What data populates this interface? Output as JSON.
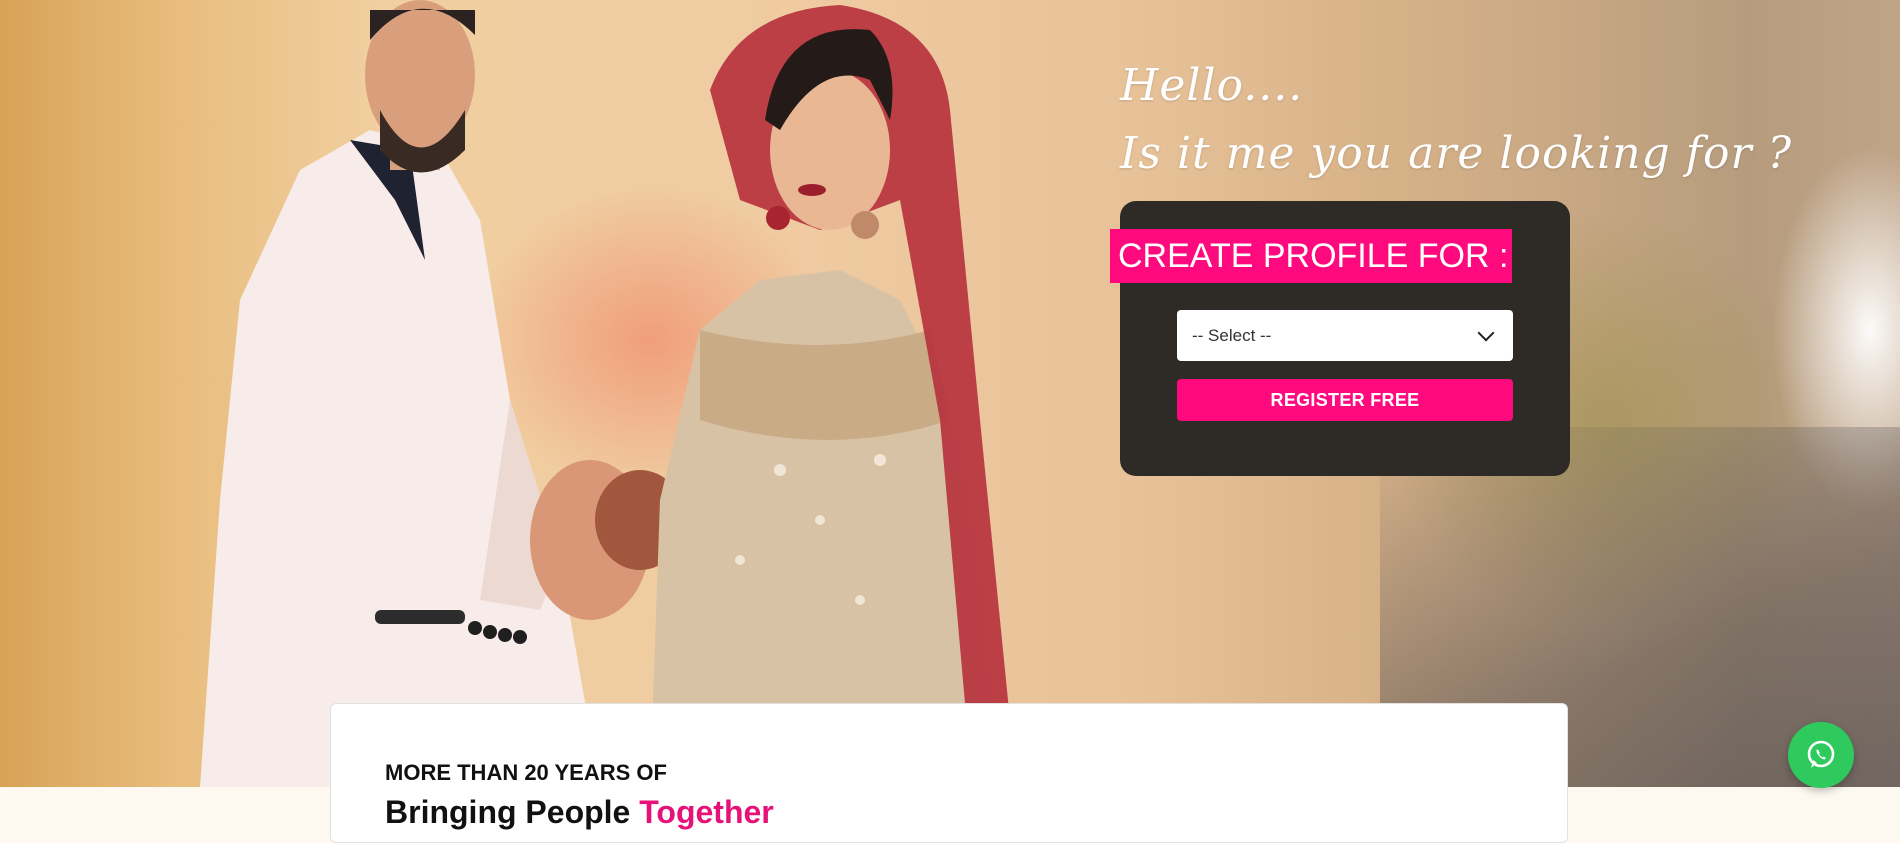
{
  "hero": {
    "greeting_line1": "Hello....",
    "greeting_line2": "Is it me you are looking for ?",
    "photo_label": "Bride and groom photo"
  },
  "profile_form": {
    "heading": "CREATE PROFILE FOR :",
    "select_value": "-- Select --",
    "register_button": "REGISTER FREE"
  },
  "about": {
    "subheading": "MORE THAN 20 YEARS OF",
    "title_part1": "Bringing People",
    "title_highlight": "Together"
  },
  "whatsapp": {
    "icon": "whatsapp-icon"
  },
  "colors": {
    "accent": "#ff0a7e",
    "card_bg": "#2e2a26",
    "whatsapp": "#2fca5d",
    "title_accent": "#e5127a"
  }
}
